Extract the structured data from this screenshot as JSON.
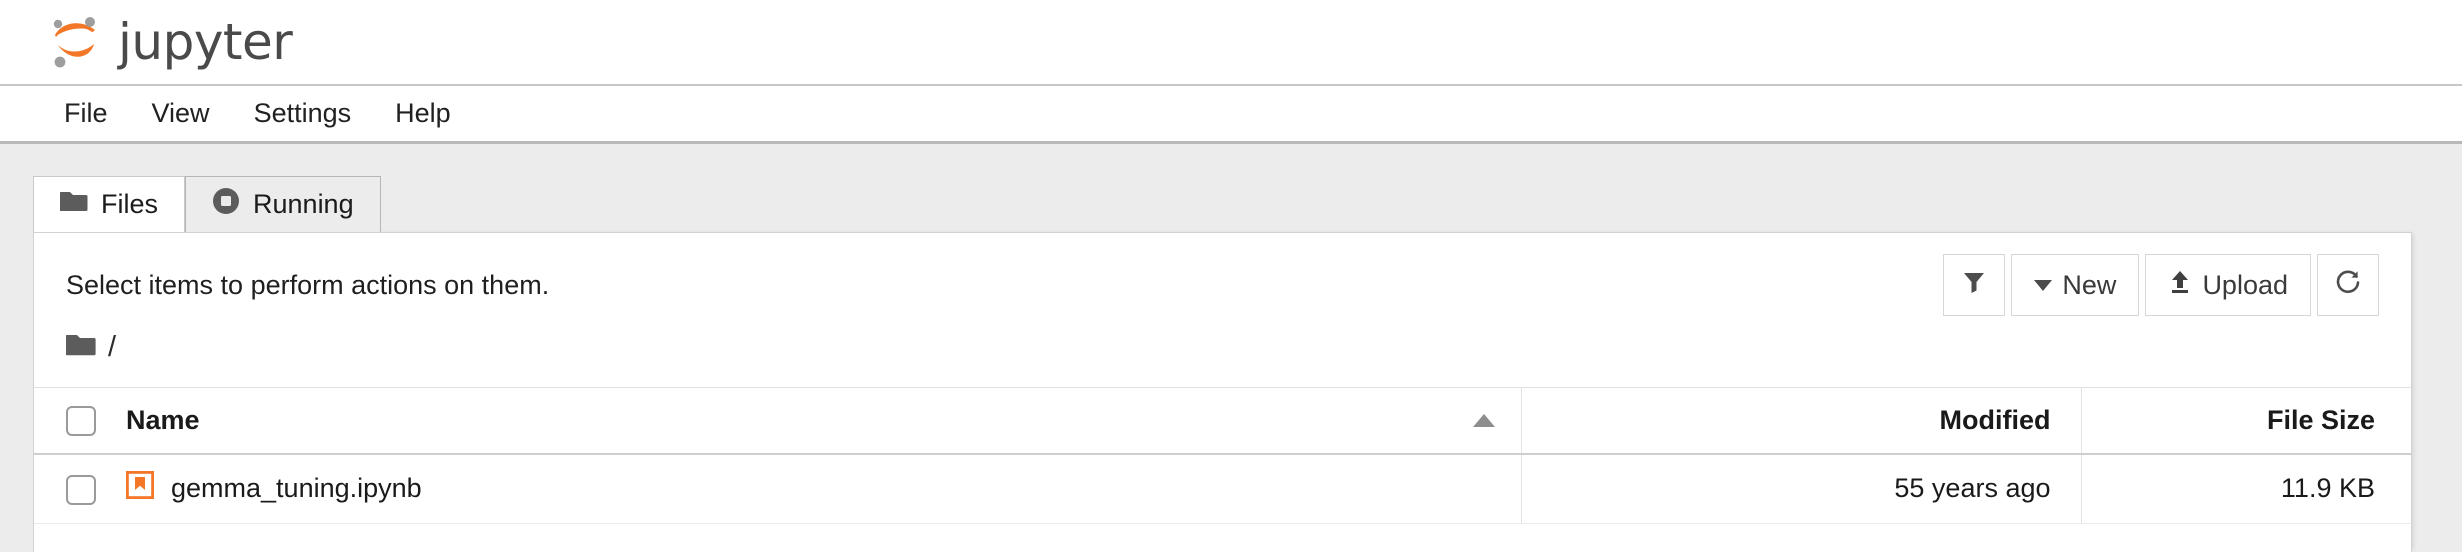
{
  "brand": {
    "wordmark": "jupyter",
    "logo_icon": "jupyter-logo-icon",
    "orange": "#f37726",
    "gray": "#9e9e9e"
  },
  "menu": {
    "items": [
      {
        "label": "File"
      },
      {
        "label": "View"
      },
      {
        "label": "Settings"
      },
      {
        "label": "Help"
      }
    ]
  },
  "tabs": [
    {
      "label": "Files",
      "icon": "folder-icon",
      "active": true
    },
    {
      "label": "Running",
      "icon": "stop-circle-icon",
      "active": false
    }
  ],
  "panel": {
    "select_hint": "Select items to perform actions on them.",
    "toolbar": [
      {
        "name": "filter-button",
        "label": "",
        "icon": "filter-funnel-icon"
      },
      {
        "name": "new-button",
        "label": "New",
        "icon": "caret-down-icon"
      },
      {
        "name": "upload-button",
        "label": "Upload",
        "icon": "upload-arrow-icon"
      },
      {
        "name": "refresh-button",
        "label": "",
        "icon": "refresh-icon"
      }
    ],
    "breadcrumb": {
      "icon": "folder-icon",
      "path": "/"
    },
    "table": {
      "columns": [
        {
          "key": "check",
          "label": ""
        },
        {
          "key": "name",
          "label": "Name",
          "sort": "asc"
        },
        {
          "key": "modified",
          "label": "Modified"
        },
        {
          "key": "size",
          "label": "File Size"
        }
      ],
      "rows": [
        {
          "name": "gemma_tuning.ipynb",
          "icon": "notebook-icon",
          "modified": "55 years ago",
          "size": "11.9 KB",
          "checked": false
        }
      ]
    }
  }
}
